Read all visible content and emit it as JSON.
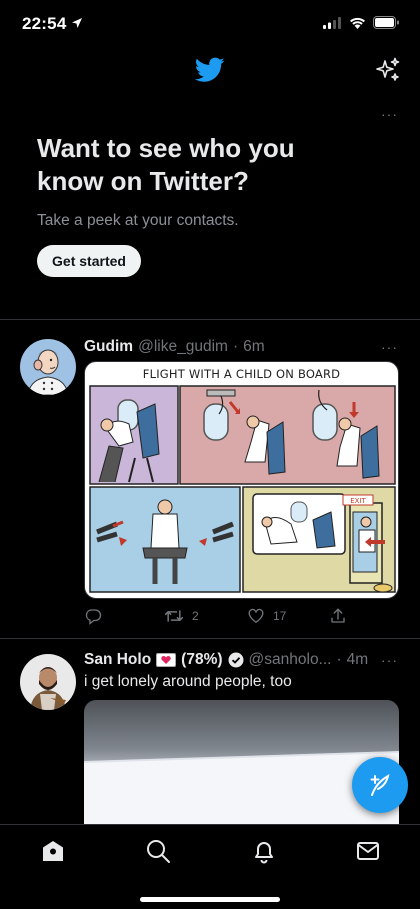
{
  "status_bar": {
    "time": "22:54"
  },
  "promo": {
    "title": "Want to see who you know on Twitter?",
    "subtitle": "Take a peek at your contacts.",
    "button_label": "Get started",
    "more_label": "···"
  },
  "tweets": [
    {
      "name": "Gudim",
      "handle": "@like_gudim",
      "dot": "·",
      "time": "6m",
      "more_label": "···",
      "media_title": "FLIGHT WITH A CHILD ON BOARD",
      "media_exit_sign": "EXIT",
      "retweets": "2",
      "likes": "17"
    },
    {
      "name": "San Holo",
      "name_suffix": "(78%)",
      "handle": "@sanholo...",
      "dot": "·",
      "time": "4m",
      "more_label": "···",
      "text": "i get lonely around people, too"
    }
  ],
  "icons": {
    "status": [
      "location-arrow-icon",
      "signal-icon",
      "wifi-icon",
      "battery-icon"
    ],
    "header": [
      "twitter-bird-icon",
      "sparkle-icon"
    ],
    "actions": [
      "reply-icon",
      "retweet-icon",
      "like-icon",
      "share-icon"
    ],
    "tabs": [
      "home-icon",
      "search-icon",
      "notifications-icon",
      "messages-icon"
    ],
    "fab": "compose-tweet-icon"
  },
  "colors": {
    "accent": "#1d9bf0",
    "background": "#000000",
    "secondary_text": "#71767b",
    "divider": "#2f3336"
  }
}
